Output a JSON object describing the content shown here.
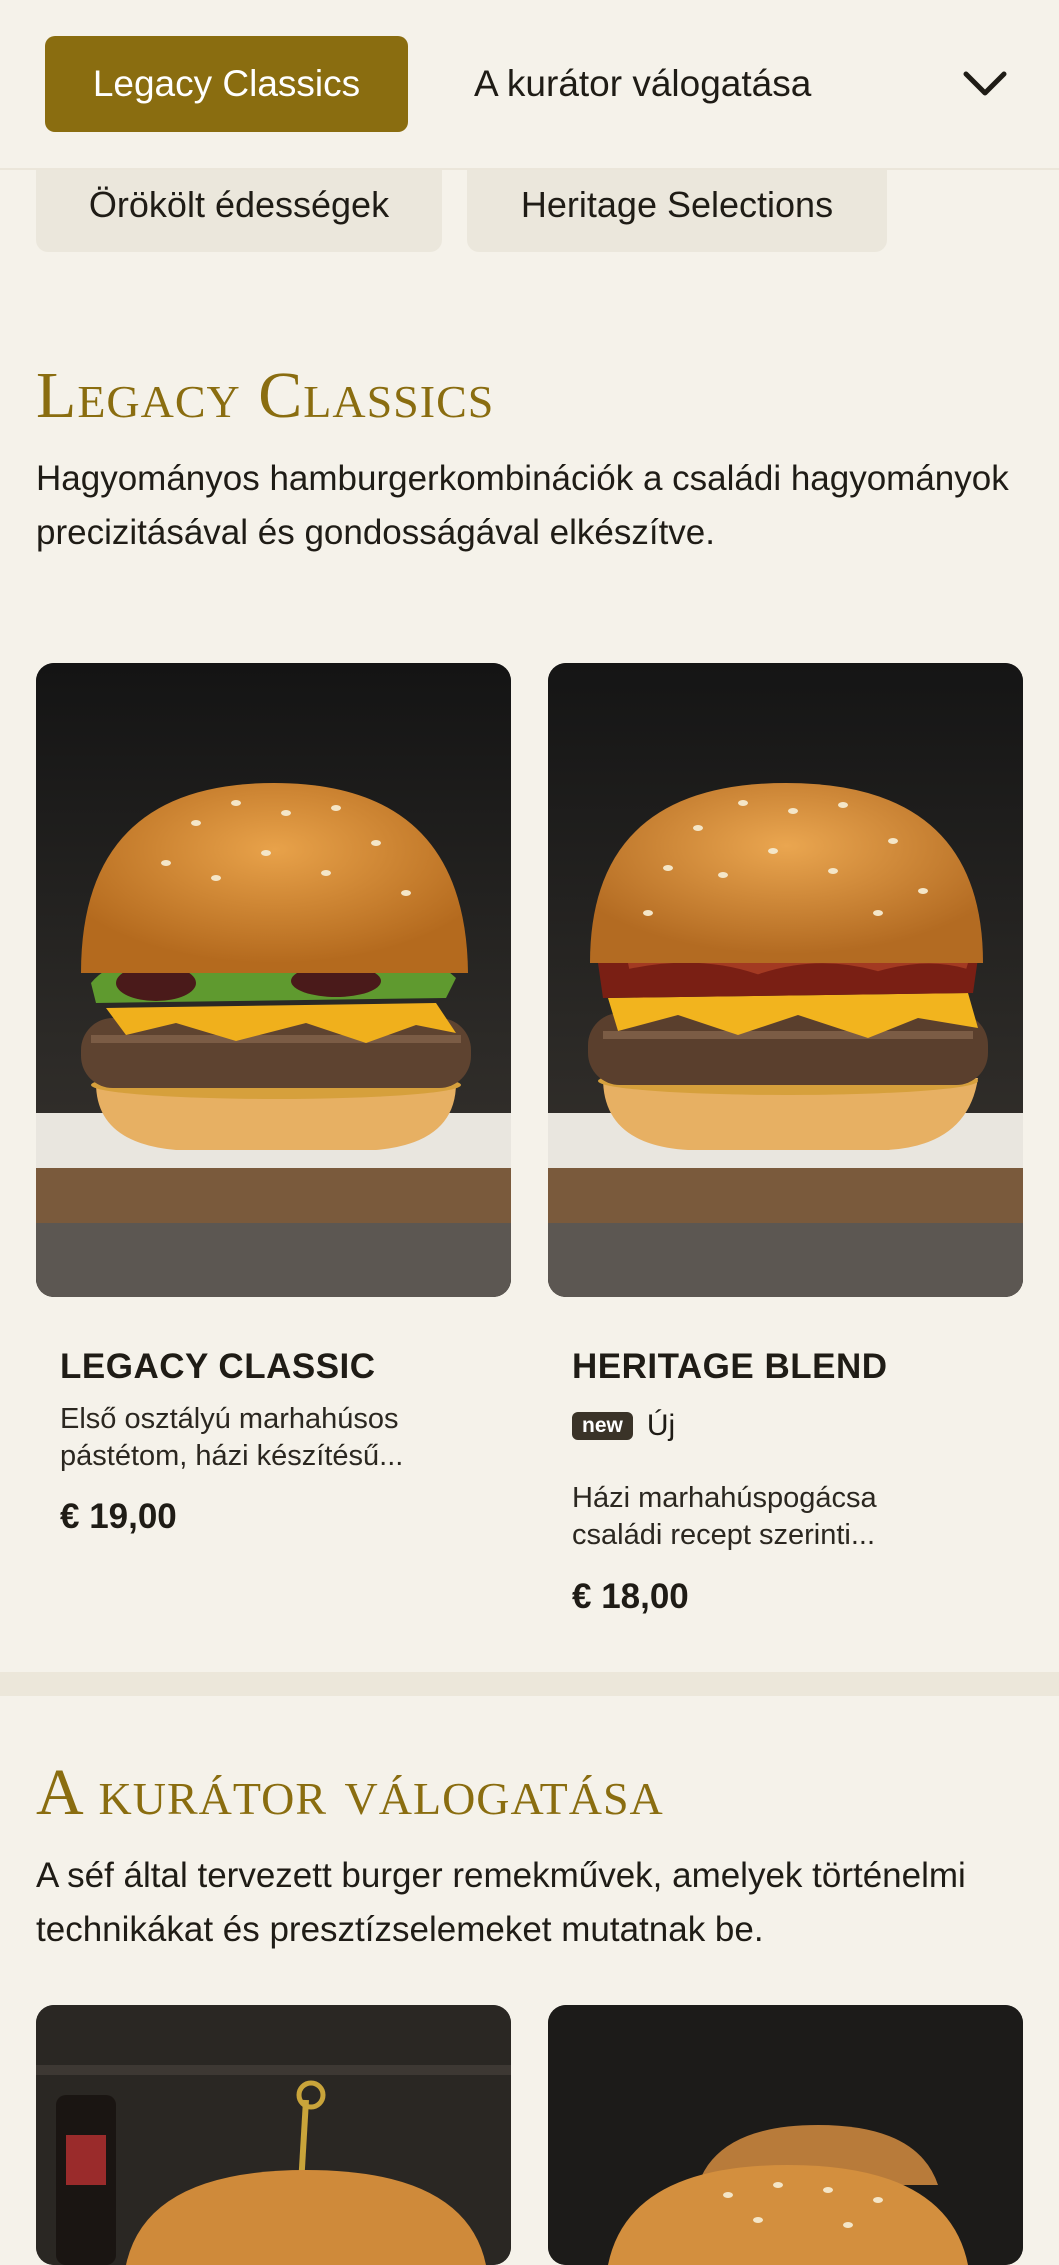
{
  "nav": {
    "active_tab": "Legacy Classics",
    "next_tab": "A kurátor válogatása",
    "secondary_tabs": [
      "Örökölt édességek",
      "Heritage Selections"
    ]
  },
  "sections": [
    {
      "title": "Legacy Classics",
      "description": "Hagyományos hamburgerkombinációk a családi hagyományok precizitásával és gondosságával elkészítve.",
      "items": [
        {
          "name": "LEGACY CLASSIC",
          "description_line1": "Első osztályú marhahúsos",
          "description_line2": "pástétom, házi készítésű...",
          "price": "€ 19,00",
          "image_icon": "burger-lettuce-icon"
        },
        {
          "name": "HERITAGE BLEND",
          "badge": "new",
          "badge_label": "Új",
          "description_line1": "Házi marhahúspogácsa",
          "description_line2": "családi recept szerinti...",
          "price": "€ 18,00",
          "image_icon": "burger-bacon-icon"
        }
      ]
    },
    {
      "title": "A kurátor válogatása",
      "description": "A séf által tervezett burger remekművek, amelyek történelmi technikákat és presztízselemeket mutatnak be."
    }
  ],
  "colors": {
    "accent": "#8a6d10",
    "background": "#f5f2ea",
    "text": "#1f1c16"
  }
}
